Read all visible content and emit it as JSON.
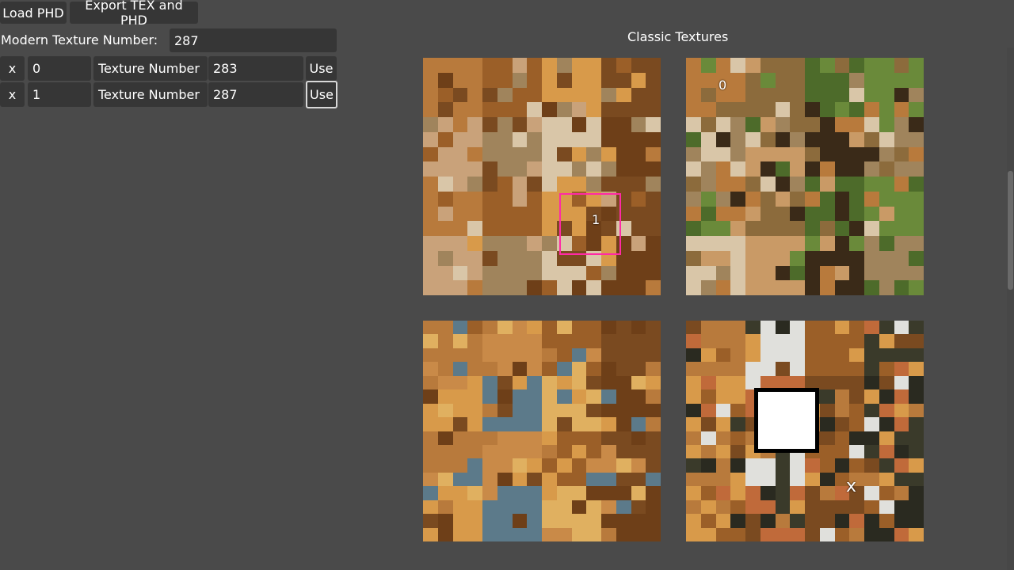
{
  "toolbar": {
    "load_label": "Load PHD",
    "export_label": "Export TEX and PHD"
  },
  "modern": {
    "label": "Modern Texture Number:",
    "value": "287"
  },
  "mappings": [
    {
      "remove_label": "x",
      "index": "0",
      "texture_label": "Texture Number",
      "texture_value": "283",
      "use_label": "Use"
    },
    {
      "remove_label": "x",
      "index": "1",
      "texture_label": "Texture Number",
      "texture_value": "287",
      "use_label": "Use"
    }
  ],
  "classic": {
    "title": "Classic Textures",
    "markers": [
      "0",
      "1"
    ],
    "extra_glyph": "x"
  },
  "colors": {
    "background": "#4a4a4a",
    "field": "#363636",
    "selection": "#ff2aa5",
    "stone": "#b87a3c",
    "dark_stone": "#7a4a20",
    "gold": "#d89a4a"
  }
}
